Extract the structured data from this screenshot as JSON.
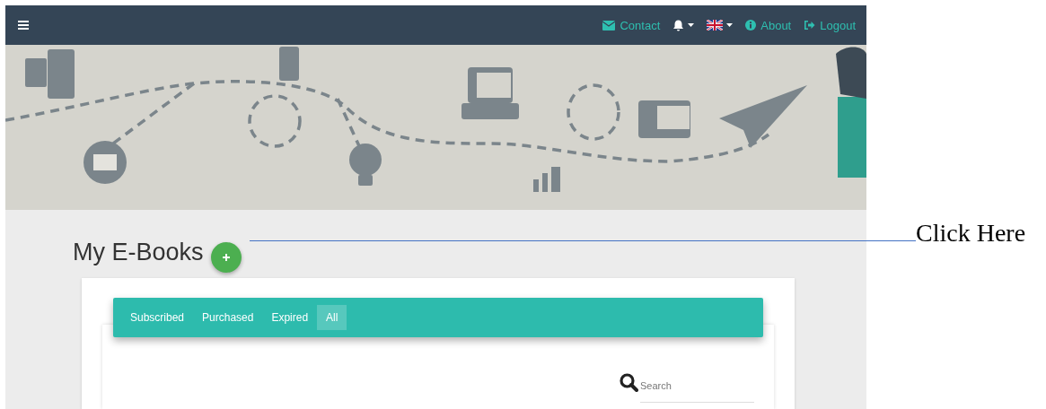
{
  "navbar": {
    "links": [
      {
        "kind": "contact",
        "label": "Contact"
      },
      {
        "kind": "bell"
      },
      {
        "kind": "flag"
      },
      {
        "kind": "about",
        "label": "About"
      },
      {
        "kind": "logout",
        "label": "Logout"
      }
    ]
  },
  "page_title": "My E-Books",
  "tabs": [
    {
      "label": "Subscribed",
      "selected": false
    },
    {
      "label": "Purchased",
      "selected": false
    },
    {
      "label": "Expired",
      "selected": false
    },
    {
      "label": "All",
      "selected": true
    }
  ],
  "search": {
    "placeholder": "Search"
  },
  "annotation": {
    "label": "Click Here"
  }
}
